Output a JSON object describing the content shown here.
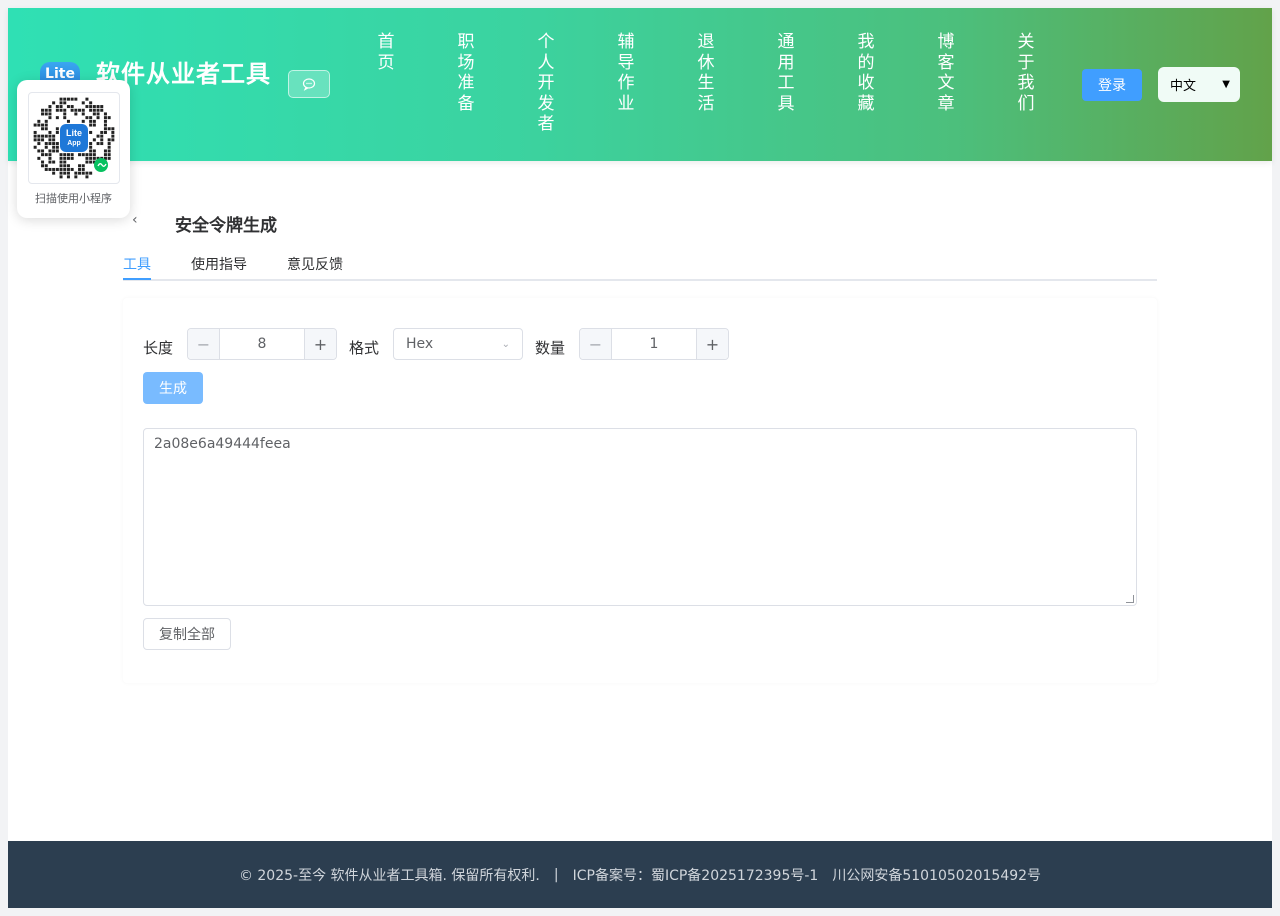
{
  "header": {
    "logo_text": "Lite",
    "title": "软件从业者工具",
    "chat_icon": "chat-bubble-icon",
    "nav": [
      "首页",
      "职场准备",
      "个人开发者",
      "辅导作业",
      "退休生活",
      "通用工具",
      "我的收藏",
      "博客文章",
      "关于我们"
    ],
    "login_label": "登录",
    "language_selected": "中文"
  },
  "qr": {
    "logo_text_1": "Lite",
    "logo_text_2": "App",
    "caption": "扫描使用小程序"
  },
  "page": {
    "title": "安全令牌生成",
    "tabs": [
      "工具",
      "使用指导",
      "意见反馈"
    ],
    "active_tab": "工具"
  },
  "form": {
    "length_label": "长度",
    "length_value": "8",
    "format_label": "格式",
    "format_value": "Hex",
    "count_label": "数量",
    "count_value": "1",
    "generate_label": "生成",
    "output": "2a08e6a49444feea",
    "copy_label": "复制全部"
  },
  "footer": {
    "copyright": "© 2025-至今 软件从业者工具箱. 保留所有权利.",
    "separator": "|",
    "icp": "ICP备案号：蜀ICP备2025172395号-1",
    "police": "川公网安备51010502015492号"
  },
  "colors": {
    "primary": "#409eff",
    "header_gradient_start": "#2fe0b4",
    "header_gradient_end": "#62a24a",
    "footer_bg": "#2c3e50"
  }
}
